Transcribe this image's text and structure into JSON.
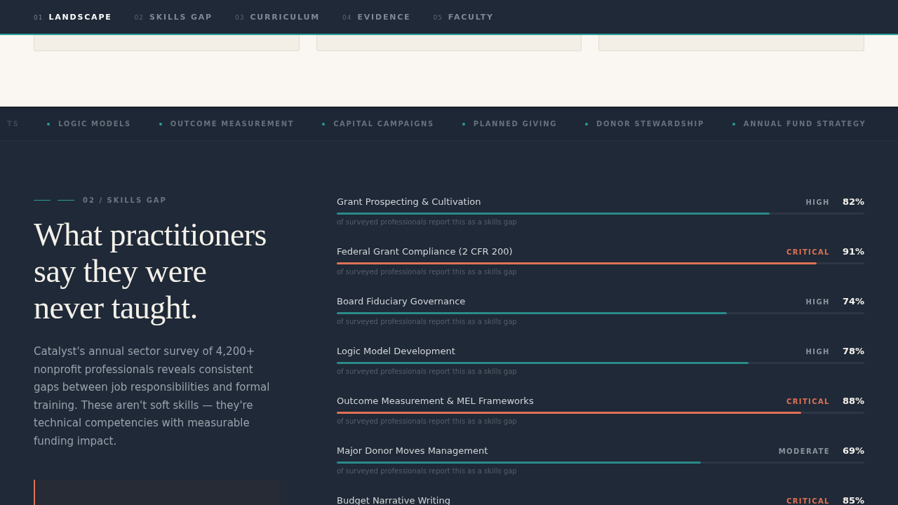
{
  "nav": {
    "items": [
      {
        "number": "01",
        "label": "LANDSCAPE",
        "selected": true
      },
      {
        "number": "02",
        "label": "SKILLS GAP",
        "selected": false
      },
      {
        "number": "03",
        "label": "CURRICULUM",
        "selected": false
      },
      {
        "number": "04",
        "label": "EVIDENCE",
        "selected": false
      },
      {
        "number": "05",
        "label": "FACULTY",
        "selected": false
      }
    ]
  },
  "marquee": {
    "items": [
      "TS",
      "LOGIC MODELS",
      "OUTCOME MEASUREMENT",
      "CAPITAL CAMPAIGNS",
      "PLANNED GIVING",
      "DONOR STEWARDSHIP",
      "ANNUAL FUND STRATEGY"
    ]
  },
  "section": {
    "eyebrow": "02 / SKILLS GAP",
    "heading": "What practitioners say they were never taught.",
    "body": "Catalyst's annual sector survey of 4,200+ nonprofit professionals reveals consistent gaps between job responsibilities and formal training. These aren't soft skills — they're technical competencies with measurable funding impact."
  },
  "skills": [
    {
      "name": "Grant Prospecting & Cultivation",
      "kind": "high",
      "severity": "HIGH",
      "percent": "82%",
      "level": 0.82,
      "note": "of surveyed professionals report this as a skills gap"
    },
    {
      "name": "Federal Grant Compliance (2 CFR 200)",
      "kind": "critical",
      "severity": "CRITICAL",
      "percent": "91%",
      "level": 0.91,
      "note": "of surveyed professionals report this as a skills gap"
    },
    {
      "name": "Board Fiduciary Governance",
      "kind": "high",
      "severity": "HIGH",
      "percent": "74%",
      "level": 0.74,
      "note": "of surveyed professionals report this as a skills gap"
    },
    {
      "name": "Logic Model Development",
      "kind": "high",
      "severity": "HIGH",
      "percent": "78%",
      "level": 0.78,
      "note": "of surveyed professionals report this as a skills gap"
    },
    {
      "name": "Outcome Measurement & MEL Frameworks",
      "kind": "critical",
      "severity": "CRITICAL",
      "percent": "88%",
      "level": 0.88,
      "note": "of surveyed professionals report this as a skills gap"
    },
    {
      "name": "Major Donor Moves Management",
      "kind": "moderate",
      "severity": "MODERATE",
      "percent": "69%",
      "level": 0.69,
      "note": "of surveyed professionals report this as a skills gap"
    },
    {
      "name": "Budget Narrative Writing",
      "kind": "critical",
      "severity": "CRITICAL",
      "percent": "85%"
    }
  ]
}
